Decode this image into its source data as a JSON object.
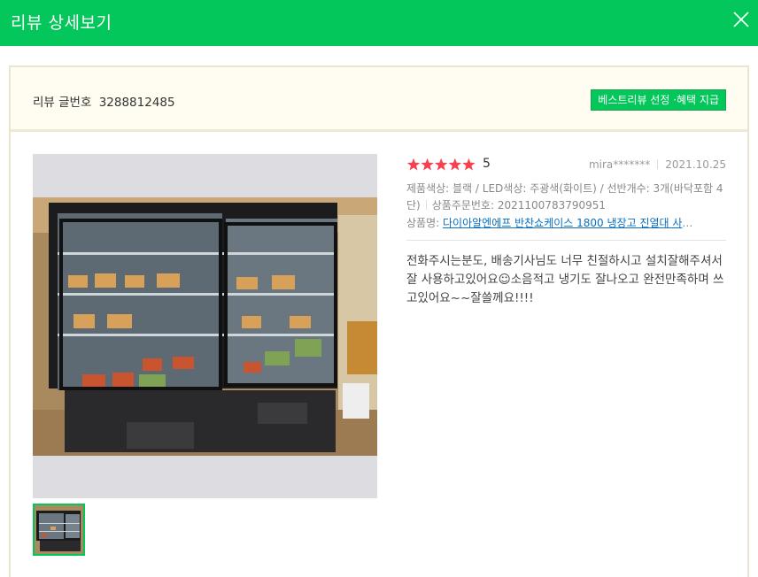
{
  "header": {
    "title": "리뷰 상세보기",
    "close_icon": "close-icon"
  },
  "review_bar": {
    "label": "리뷰 글번호",
    "number": "3288812485",
    "badge": "베스트리뷰 선정 ·혜택 지급"
  },
  "review": {
    "rating": "5",
    "stars_filled": 5,
    "user": "mira*******",
    "date": "2021.10.25",
    "options": "제품색상: 블랙 / LED색상: 주광색(화이트) / 선반개수: 3개(바닥포함 4단)",
    "order_label": "상품주문번호:",
    "order_number": "2021100783790951",
    "product_label": "상품명:",
    "product_name": "다이아알엔에프 반찬쇼케이스 1800 냉장고 진열대 사",
    "text": "전화주시는분도, 배송기사님도 너무 친절하시고 설치잘해주셔서 잘 사용하고있어요☺소음적고 냉기도 잘나오고 완전만족하며 쓰고있어요~~잘쓸께요!!!!"
  },
  "colors": {
    "brand_green": "#03c75a",
    "star_red": "#f5424e",
    "link_blue": "#0a6fc2"
  }
}
